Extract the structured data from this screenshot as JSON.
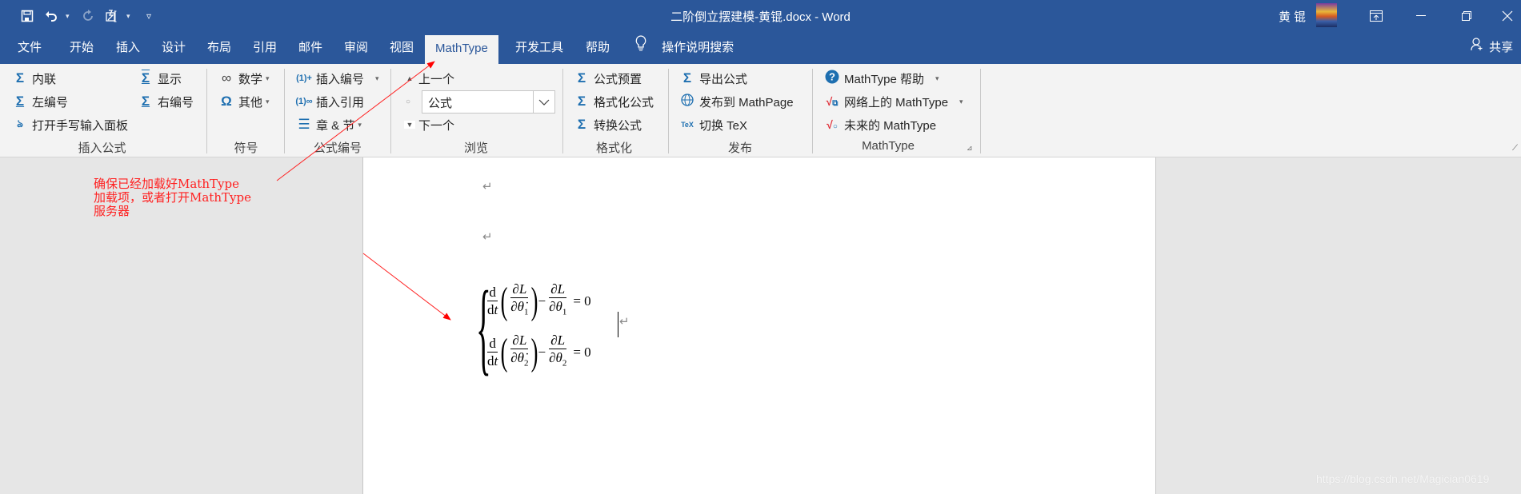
{
  "titlebar": {
    "title": "二阶倒立摆建模-黄锟.docx  -  Word",
    "user_name": "黄 锟",
    "qat": {
      "save_icon": "💾",
      "undo_icon": "↶",
      "redo_icon": "↻",
      "touch_icon": "✍",
      "customize_icon": "▿",
      "caret": "▾"
    },
    "window_buttons": {
      "ribbon_display": "⊡",
      "minimize": "—",
      "restore": "❐",
      "close": "✕"
    }
  },
  "tabs": [
    {
      "label": "文件"
    },
    {
      "label": "开始"
    },
    {
      "label": "插入"
    },
    {
      "label": "设计"
    },
    {
      "label": "布局"
    },
    {
      "label": "引用"
    },
    {
      "label": "邮件"
    },
    {
      "label": "审阅"
    },
    {
      "label": "视图"
    },
    {
      "label": "MathType",
      "active": true
    },
    {
      "label": "开发工具"
    },
    {
      "label": "帮助"
    }
  ],
  "tell_me": {
    "icon": "💡",
    "label": "操作说明搜索"
  },
  "share": {
    "icon": "⚲",
    "label": "共享"
  },
  "ribbon": {
    "insert_equation": {
      "label": "插入公式",
      "items": {
        "inline": {
          "icon": "Σ",
          "label": "内联"
        },
        "display": {
          "icon": "Σ",
          "label": "显示"
        },
        "left_number": {
          "icon": "Σ",
          "label": "左编号"
        },
        "right_number": {
          "icon": "Σ",
          "label": "右编号"
        },
        "handwriting": {
          "icon": "ঌ",
          "label": "打开手写输入面板"
        }
      }
    },
    "symbols": {
      "label": "符号",
      "items": {
        "math": {
          "icon": "∞",
          "label": "数学"
        },
        "other": {
          "icon": "Ω",
          "label": "其他"
        }
      }
    },
    "equation_numbers": {
      "label": "公式编号",
      "items": {
        "insert_number": {
          "icon": "⁽¹⁾",
          "label": "插入编号"
        },
        "insert_reference": {
          "icon": "⁽¹⁾",
          "label": "插入引用"
        },
        "chapter_section": {
          "icon": "☰",
          "label": "章 & 节"
        }
      }
    },
    "browse": {
      "label": "浏览",
      "items": {
        "previous": {
          "icon": "▲",
          "label": "上一个"
        },
        "combo_value": "公式",
        "next": {
          "icon": "▼",
          "label": "下一个"
        }
      }
    },
    "format": {
      "label": "格式化",
      "items": {
        "preset": {
          "icon": "Σ",
          "label": "公式预置"
        },
        "format_eq": {
          "icon": "Σ",
          "label": "格式化公式"
        },
        "convert": {
          "icon": "Σ",
          "label": "转换公式"
        }
      }
    },
    "publish": {
      "label": "发布",
      "items": {
        "export": {
          "icon": "Σ",
          "label": "导出公式"
        },
        "mathpage": {
          "icon": "🌐",
          "label": "发布到 MathPage"
        },
        "toggle_tex": {
          "icon": "TeX",
          "label": "切换 TeX"
        }
      }
    },
    "mathtype": {
      "label": "MathType",
      "items": {
        "help": {
          "icon": "?",
          "label": "MathType 帮助"
        },
        "online": {
          "icon": "√",
          "label": "网络上的 MathType"
        },
        "future": {
          "icon": "√",
          "label": "未来的 MathType"
        }
      }
    }
  },
  "document": {
    "paragraph_mark": "↵",
    "equation": {
      "d": "d",
      "dt": "dt",
      "partial_L": "∂L",
      "partial_theta1": "∂θ̇",
      "sub1": "1",
      "sub2": "2",
      "minus": "−",
      "equals_zero": "= 0"
    }
  },
  "annotation": {
    "text": "确保已经加载好MathType\n加载项，或者打开MathType\n服务器",
    "color": "#ff2020"
  },
  "watermark": "https://blog.csdn.net/Magician0619"
}
